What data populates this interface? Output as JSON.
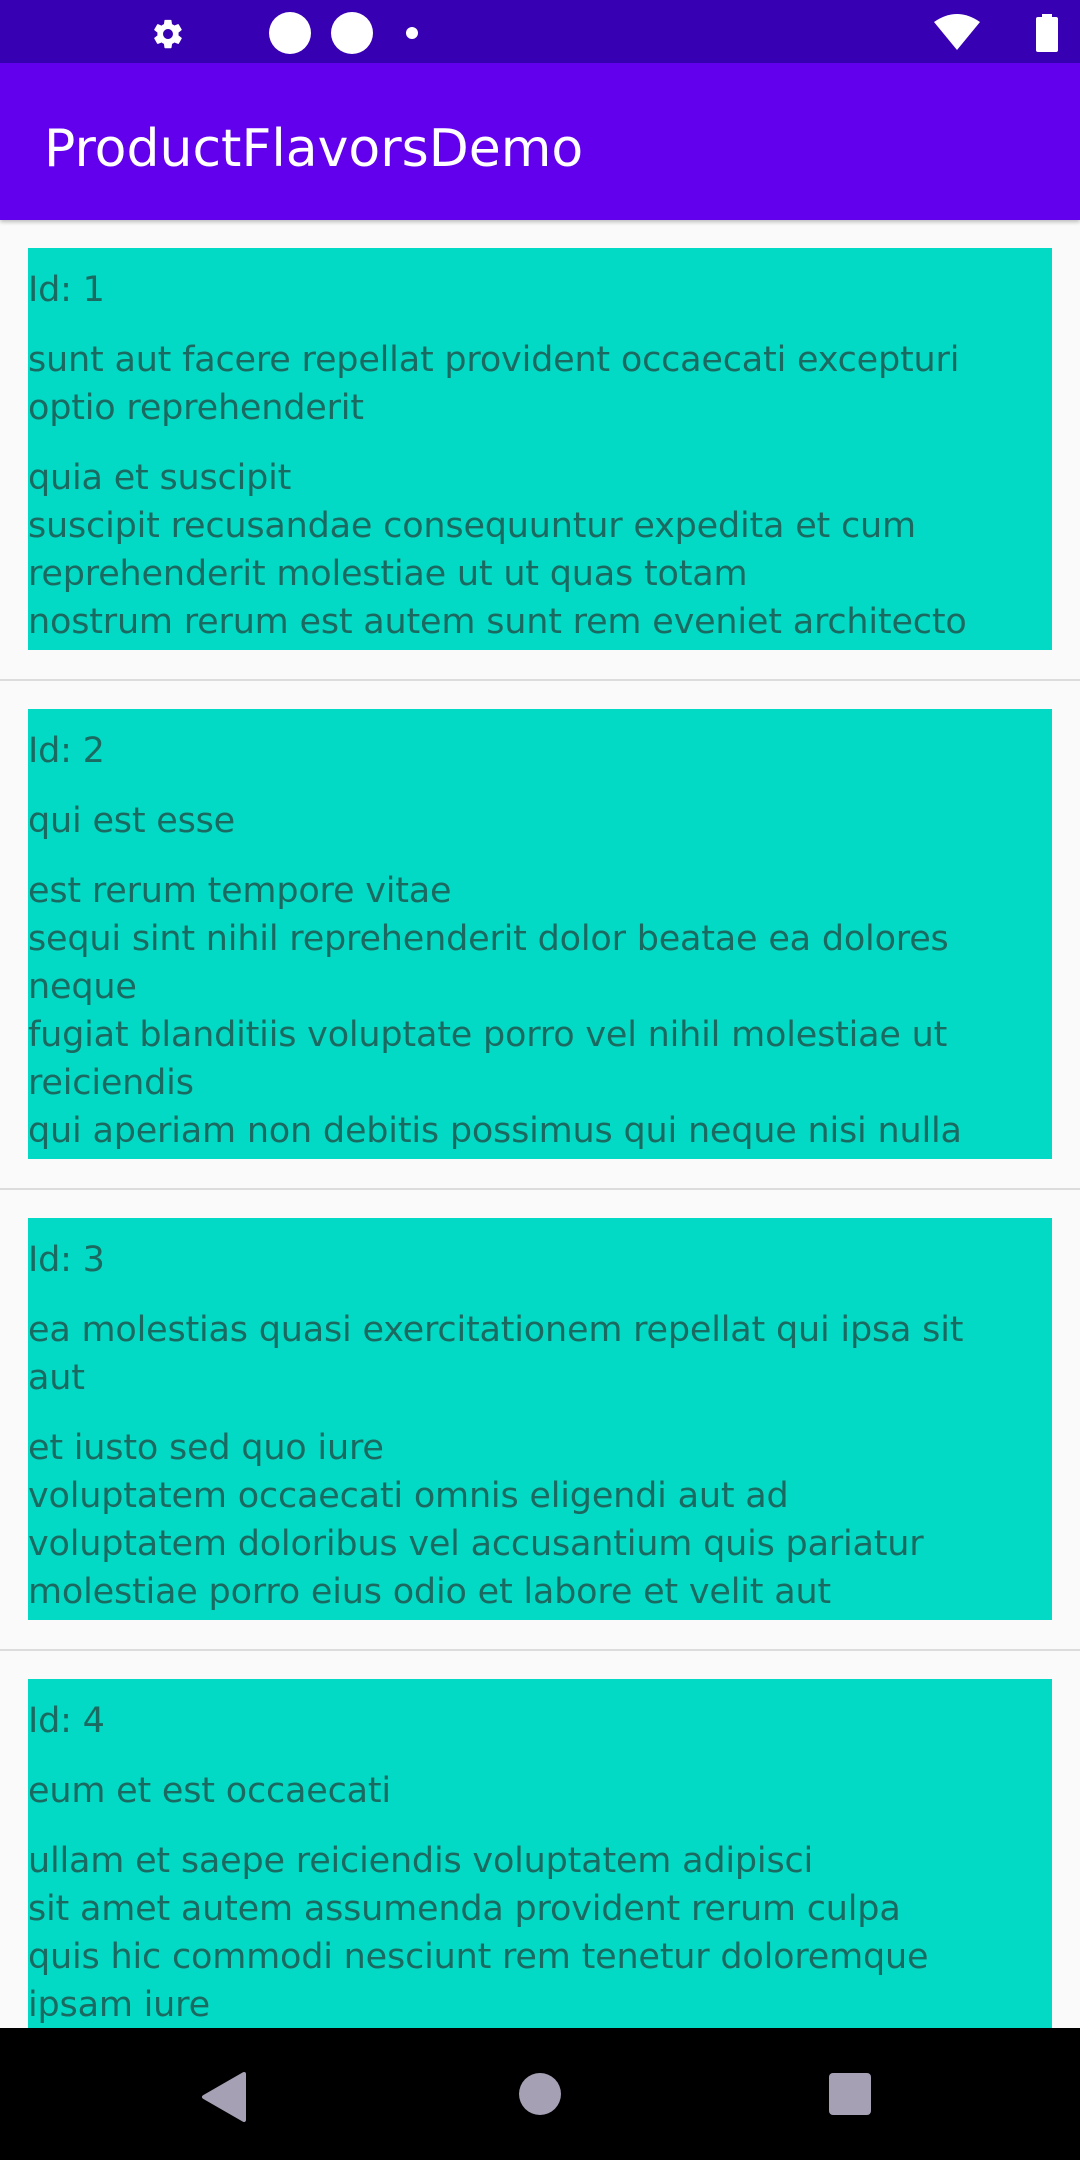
{
  "app": {
    "title": "ProductFlavorsDemo"
  },
  "status_bar": {
    "icons": [
      "gear-icon",
      "circle-icon",
      "circle-icon",
      "dot-icon",
      "wifi-icon",
      "battery-icon"
    ]
  },
  "posts": [
    {
      "id_label": "Id: 1",
      "title_lines": [
        "sunt aut facere repellat provident occaecati excepturi",
        "optio reprehenderit"
      ],
      "body_lines": [
        "quia et suscipit",
        "suscipit recusandae consequuntur expedita et cum",
        "reprehenderit molestiae ut ut quas totam",
        "nostrum rerum est autem sunt rem eveniet architecto"
      ]
    },
    {
      "id_label": "Id: 2",
      "title_lines": [
        "qui est esse"
      ],
      "body_lines": [
        "est rerum tempore vitae",
        "sequi sint nihil reprehenderit dolor beatae ea dolores",
        "neque",
        "fugiat blanditiis voluptate porro vel nihil molestiae ut",
        "reiciendis",
        "qui aperiam non debitis possimus qui neque nisi nulla"
      ]
    },
    {
      "id_label": "Id: 3",
      "title_lines": [
        "ea molestias quasi exercitationem repellat qui ipsa sit",
        "aut"
      ],
      "body_lines": [
        "et iusto sed quo iure",
        "voluptatem occaecati omnis eligendi aut ad",
        "voluptatem doloribus vel accusantium quis pariatur",
        "molestiae porro eius odio et labore et velit aut"
      ]
    },
    {
      "id_label": "Id: 4",
      "title_lines": [
        "eum et est occaecati"
      ],
      "body_lines": [
        "ullam et saepe reiciendis voluptatem adipisci",
        "sit amet autem assumenda provident rerum culpa",
        "quis hic commodi nesciunt rem tenetur doloremque",
        "ipsam iure"
      ]
    }
  ],
  "nav_bar": {
    "buttons": [
      "back-icon",
      "home-icon",
      "recents-icon"
    ]
  },
  "colors": {
    "status_bar": "#3700b3",
    "app_bar": "#6200ee",
    "card": "#03dac5",
    "card_text": "#1b6a61",
    "background": "#fafafa"
  }
}
